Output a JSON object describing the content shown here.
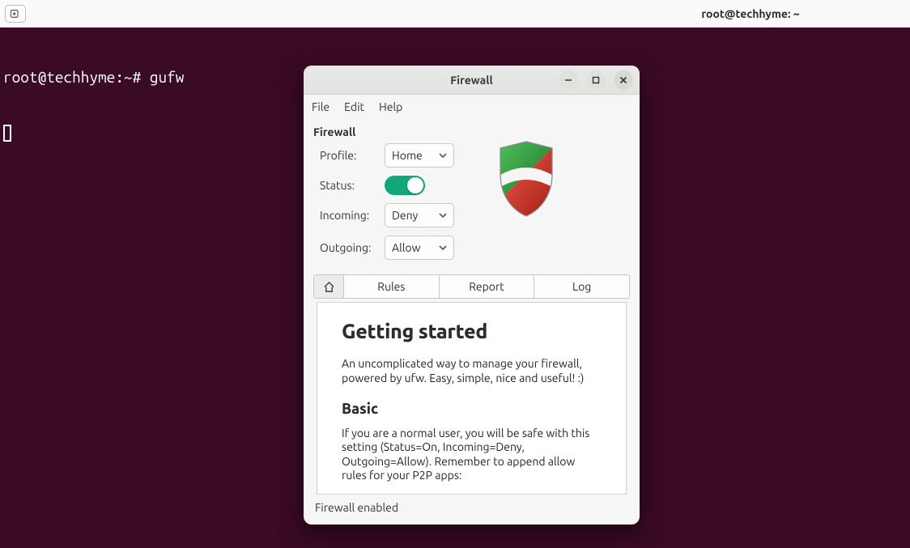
{
  "desktop": {
    "window_title": "root@techhyme: ~",
    "new_tab_icon": "new-tab-icon"
  },
  "terminal": {
    "prompt": "root@techhyme:~#",
    "command": "gufw"
  },
  "app": {
    "title": "Firewall",
    "menu": {
      "file": "File",
      "edit": "Edit",
      "help": "Help"
    },
    "section_label": "Firewall",
    "labels": {
      "profile": "Profile:",
      "status": "Status:",
      "incoming": "Incoming:",
      "outgoing": "Outgoing:"
    },
    "values": {
      "profile": "Home",
      "status_on": true,
      "incoming": "Deny",
      "outgoing": "Allow"
    },
    "tabs": {
      "home": "home-icon",
      "rules": "Rules",
      "report": "Report",
      "log": "Log",
      "active": "home"
    },
    "panel": {
      "h1": "Getting started",
      "p1": "An uncomplicated way to manage your firewall, powered by ufw. Easy, simple, nice and useful! :)",
      "h2": "Basic",
      "p2": "If you are a normal user, you will be safe with this setting (Status=On, Incoming=Deny, Outgoing=Allow). Remember to append allow rules for your P2P apps:"
    },
    "statusbar": "Firewall enabled",
    "colors": {
      "switch_on": "#12a67a",
      "terminal_bg": "#3b0a24",
      "shield_green": "#2e8f3d",
      "shield_red": "#d8332b",
      "shield_white": "#f5f5f5"
    }
  }
}
